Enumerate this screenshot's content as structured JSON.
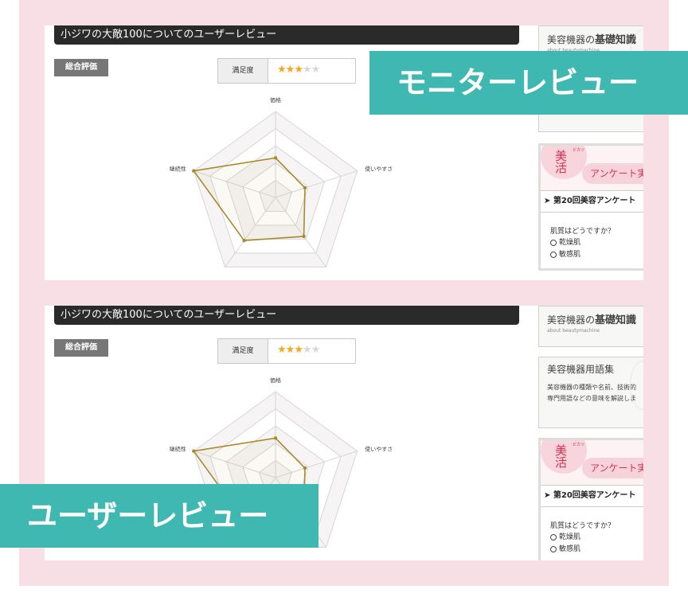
{
  "review_section": {
    "title": "小ジワの大敵100についてのユーザーレビュー",
    "overall_badge": "総合評価",
    "satisfaction_label": "満足度",
    "satisfaction_rating": 3,
    "satisfaction_max": 5
  },
  "chart_data": {
    "type": "radar",
    "axes": [
      "価格",
      "使いやすさ",
      "",
      "",
      "継続性"
    ],
    "values": [
      2.3,
      1.8,
      2.8,
      3.1,
      5.0
    ],
    "max": 5,
    "series_color": "#a88a2c"
  },
  "sidebar": {
    "basics_card": {
      "title_prefix": "美容機器の",
      "title_bold": "基礎知識",
      "subtitle": "about beautymachine"
    },
    "glossary_card": {
      "title": "美容機器用語集",
      "desc_line1": "美容機器の種類や名前、技術的",
      "desc_line2": "専門用語などの意味を解説しま"
    },
    "survey_card": {
      "logo": "美活",
      "logo_ruby": "ビカツ",
      "ribbon": "アンケート実",
      "heading": "第20回美容アンケート",
      "question": "肌質はどうですか？",
      "options": [
        "乾燥肌",
        "敏感肌"
      ]
    }
  },
  "banners": {
    "monitor": "モニターレビュー",
    "user": "ユーザーレビュー"
  },
  "colors": {
    "frame": "#f7dfe5",
    "banner": "#3fb8b1",
    "titlebar": "#2a2a2a",
    "star": "#f5a623"
  }
}
